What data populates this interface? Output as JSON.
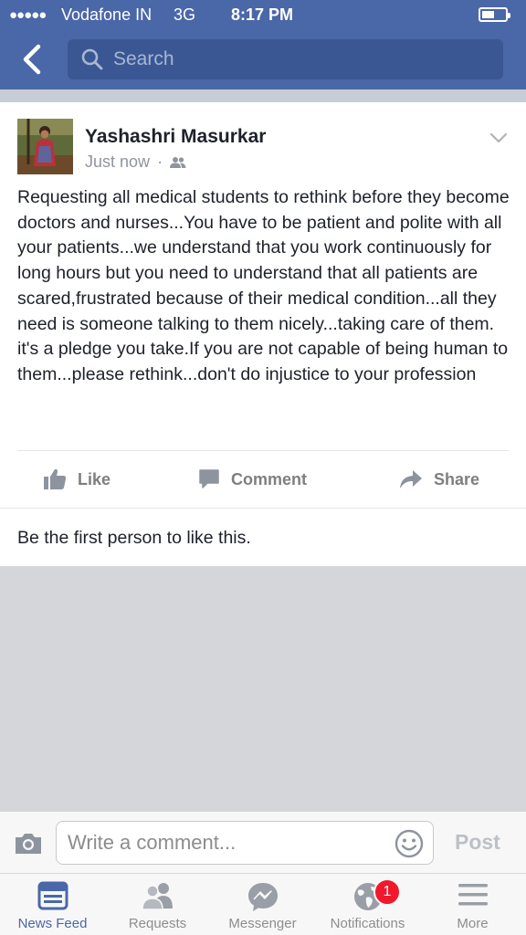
{
  "status_bar": {
    "signal": "●●●●●",
    "carrier": "Vodafone IN",
    "network": "3G",
    "time": "8:17 PM"
  },
  "header": {
    "search_placeholder": "Search",
    "back_icon": "chevron-left-icon",
    "search_icon": "search-icon"
  },
  "post": {
    "author": "Yashashri Masurkar",
    "timestamp": "Just now",
    "separator": "·",
    "audience_icon": "friends-icon",
    "text": "Requesting all medical students to rethink before they become doctors and nurses...You have to be patient and polite with all your patients...we understand that you work continuously for long hours but you need to understand that all patients are scared,frustrated because of their medical condition...all they need is someone talking to them nicely...taking care of them. it's a pledge you take.If you are not capable of being human to them...please rethink...don't do injustice to your profession",
    "actions": {
      "like": "Like",
      "comment": "Comment",
      "share": "Share"
    },
    "likes_summary": "Be the first person to like this."
  },
  "composer": {
    "placeholder": "Write a comment...",
    "post_label": "Post"
  },
  "tabbar": {
    "tabs": [
      {
        "label": "News Feed",
        "icon": "news-feed-icon",
        "active": true
      },
      {
        "label": "Requests",
        "icon": "friend-requests-icon"
      },
      {
        "label": "Messenger",
        "icon": "messenger-icon"
      },
      {
        "label": "Notifications",
        "icon": "globe-icon",
        "badge": "1"
      },
      {
        "label": "More",
        "icon": "menu-icon"
      }
    ]
  },
  "colors": {
    "brand_blue": "#4a67a8",
    "search_bg": "#3a5794",
    "badge_red": "#f0192b",
    "muted_gray": "#90949c"
  }
}
